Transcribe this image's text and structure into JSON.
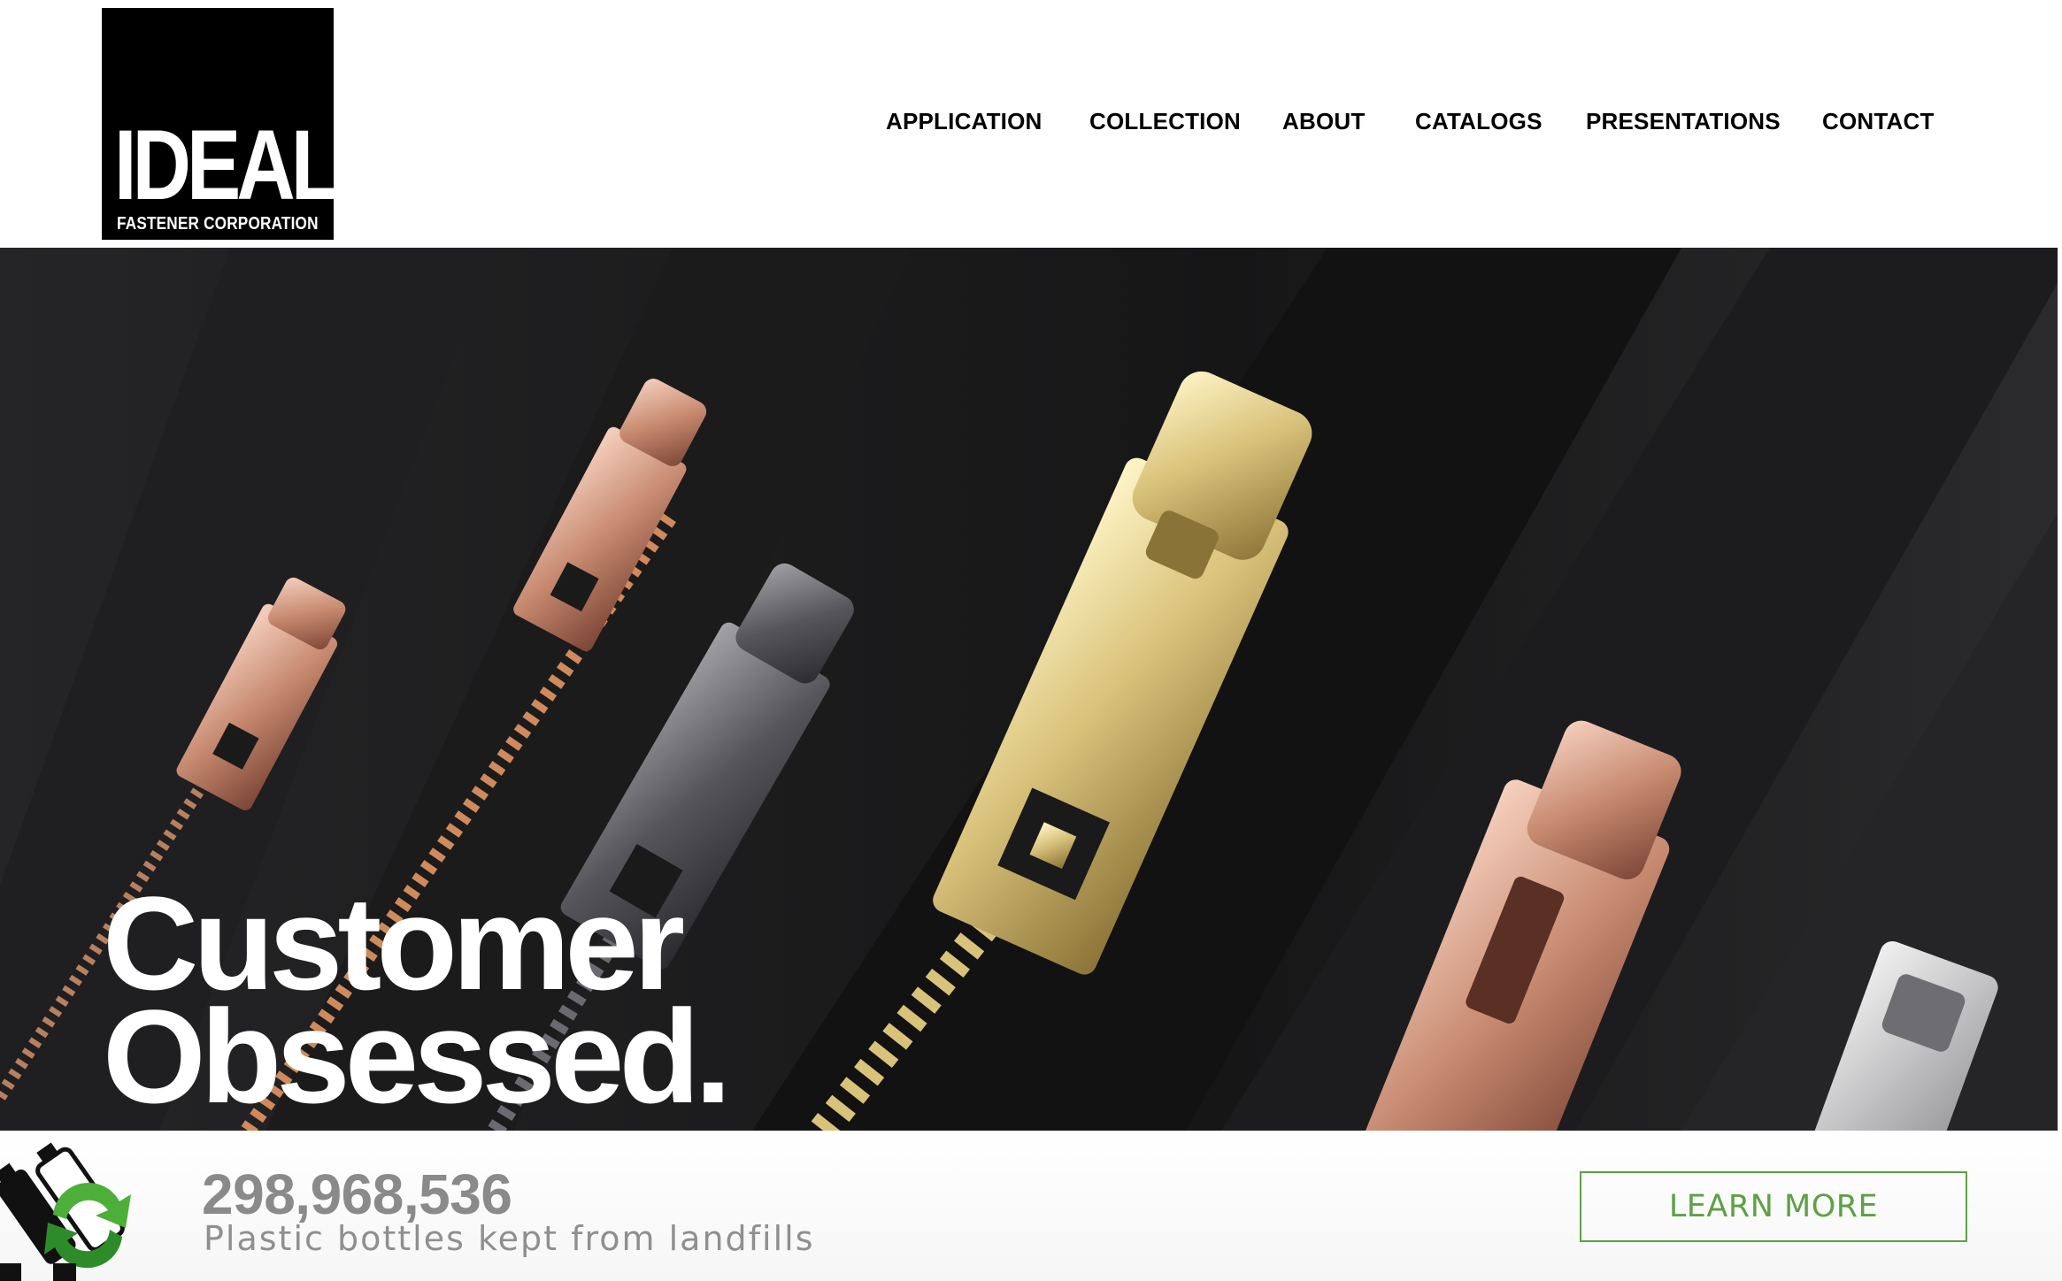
{
  "brand": {
    "name": "IDEAL",
    "subtitle": "FASTENER CORPORATION"
  },
  "nav": {
    "items": [
      {
        "label": "APPLICATION"
      },
      {
        "label": "COLLECTION"
      },
      {
        "label": "ABOUT"
      },
      {
        "label": "CATALOGS"
      },
      {
        "label": "PRESENTATIONS"
      },
      {
        "label": "CONTACT"
      }
    ]
  },
  "hero": {
    "headline_line1": "Customer",
    "headline_line2": "Obsessed."
  },
  "stats": {
    "count": "298,968,536",
    "label": "Plastic bottles kept from landfills",
    "button_label": "LEARN MORE",
    "accent_color": "#5fa046"
  }
}
